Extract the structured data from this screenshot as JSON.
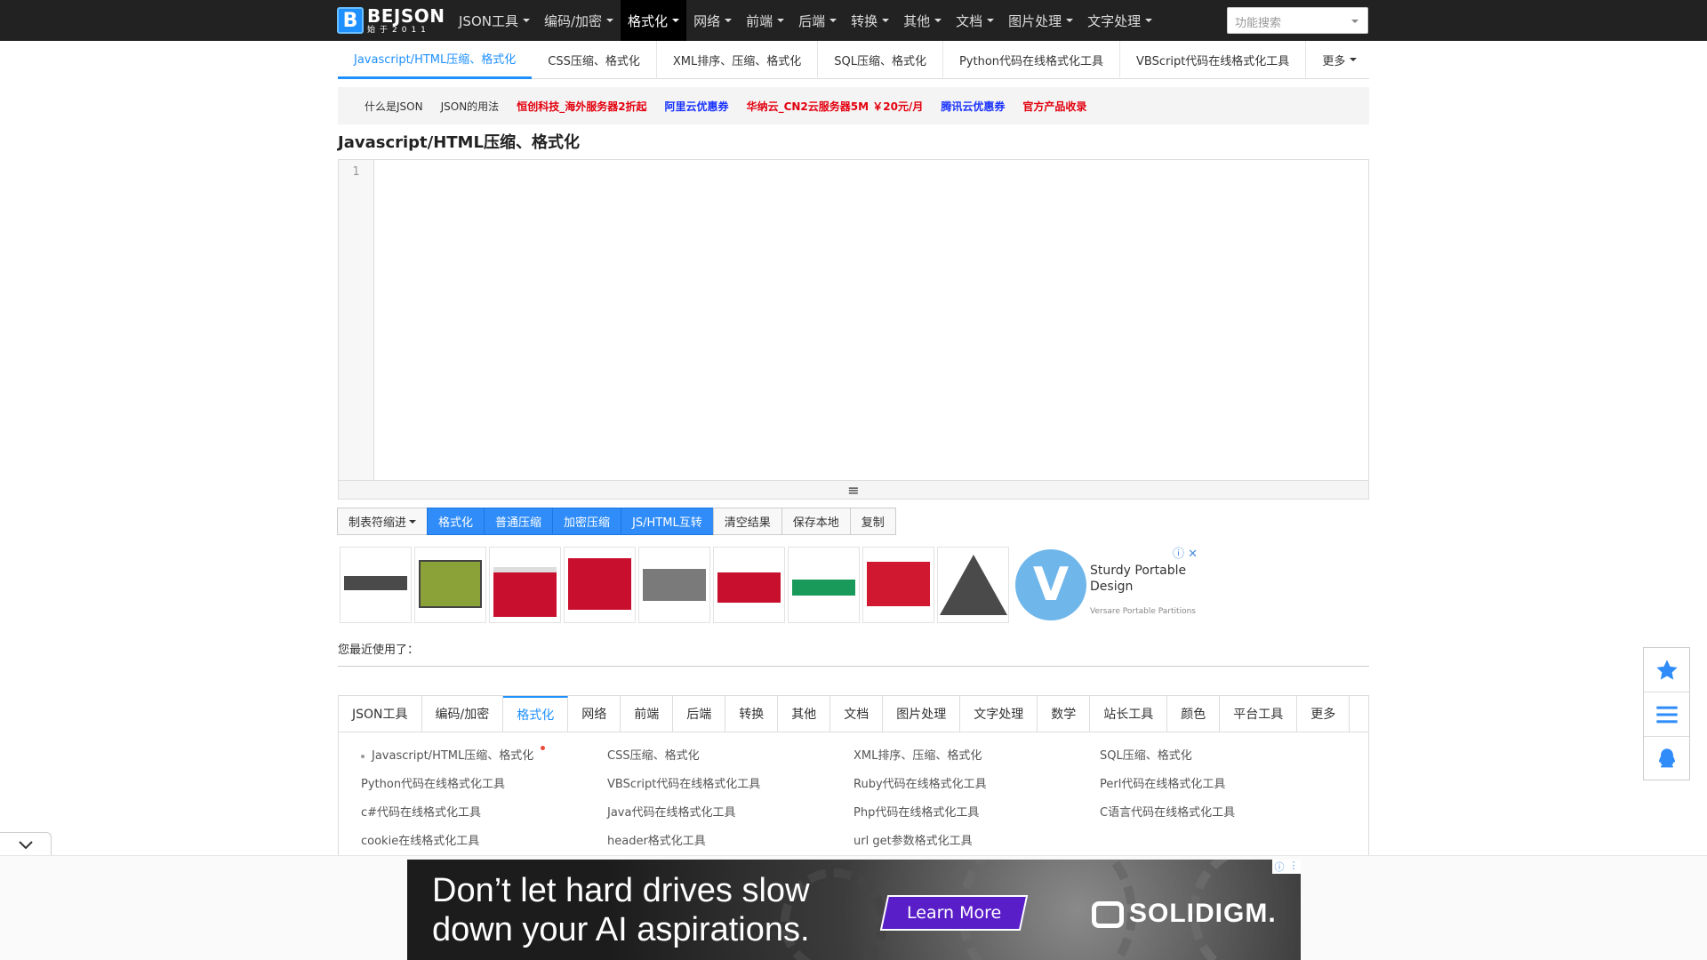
{
  "logo": {
    "main": "BEJSON",
    "sub": "始于2011"
  },
  "nav": {
    "items": [
      {
        "label": "JSON工具"
      },
      {
        "label": "编码/加密"
      },
      {
        "label": "格式化"
      },
      {
        "label": "网络"
      },
      {
        "label": "前端"
      },
      {
        "label": "后端"
      },
      {
        "label": "转换"
      },
      {
        "label": "其他"
      },
      {
        "label": "文档"
      },
      {
        "label": "图片处理"
      },
      {
        "label": "文字处理"
      }
    ],
    "active_index": 2,
    "search_placeholder": "功能搜索"
  },
  "subtabs": [
    {
      "label": "Javascript/HTML压缩、格式化"
    },
    {
      "label": "CSS压缩、格式化"
    },
    {
      "label": "XML排序、压缩、格式化"
    },
    {
      "label": "SQL压缩、格式化"
    },
    {
      "label": "Python代码在线格式化工具"
    },
    {
      "label": "VBScript代码在线格式化工具"
    },
    {
      "label": "更多"
    }
  ],
  "links": [
    {
      "label": "什么是JSON",
      "style": "plain"
    },
    {
      "label": "JSON的用法",
      "style": "plain"
    },
    {
      "label": "恒创科技_海外服务器2折起",
      "style": "red"
    },
    {
      "label": "阿里云优惠券",
      "style": "blue"
    },
    {
      "label": "华纳云_CN2云服务器5M ￥20元/月",
      "style": "red"
    },
    {
      "label": "腾讯云优惠券",
      "style": "blue"
    },
    {
      "label": "官方产品收录",
      "style": "red"
    }
  ],
  "page_title": "Javascript/HTML压缩、格式化",
  "editor": {
    "line_number": "1",
    "resize_glyph": "≡"
  },
  "toolbar": {
    "indent": "制表符缩进",
    "format": "格式化",
    "compress": "普通压缩",
    "encrypt": "加密压缩",
    "jshtml": "JS/HTML互转",
    "clear": "清空结果",
    "save": "保存本地",
    "copy": "复制"
  },
  "ad": {
    "title": "Sturdy Portable Design",
    "sub": "Versare Portable Partitions",
    "logo_letter": "V",
    "info_icon": "ⓘ",
    "close_icon": "✕"
  },
  "recent_label": "您最近使用了：",
  "bottom_tabs": [
    "JSON工具",
    "编码/加密",
    "格式化",
    "网络",
    "前端",
    "后端",
    "转换",
    "其他",
    "文档",
    "图片处理",
    "文字处理",
    "数学",
    "站长工具",
    "颜色",
    "平台工具",
    "更多"
  ],
  "bottom_links": [
    "Javascript/HTML压缩、格式化",
    "CSS压缩、格式化",
    "XML排序、压缩、格式化",
    "SQL压缩、格式化",
    "Python代码在线格式化工具",
    "VBScript代码在线格式化工具",
    "Ruby代码在线格式化工具",
    "Perl代码在线格式化工具",
    "c#代码在线格式化工具",
    "Java代码在线格式化工具",
    "Php代码在线格式化工具",
    "C语言代码在线格式化工具",
    "cookie在线格式化工具",
    "header格式化工具",
    "url get参数格式化工具"
  ],
  "banner": {
    "line1": "Don’t let hard drives slow",
    "line2": "down your AI aspirations.",
    "cta": "Learn More",
    "brand": "SOLIDIGM."
  },
  "colors": {
    "accent": "#1e90ff",
    "nav_bg": "#222222",
    "primary_btn": "#2f8cf8",
    "link_red": "#e3000f",
    "link_blue": "#1a33ff"
  }
}
